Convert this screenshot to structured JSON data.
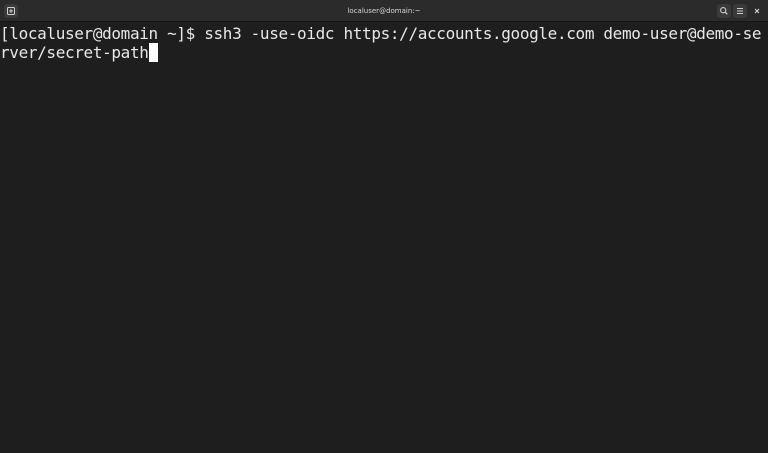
{
  "window": {
    "title": "localuser@domain:~"
  },
  "titlebar": {
    "new_tab_icon": "new-tab-icon",
    "search_icon": "search-icon",
    "menu_icon": "hamburger-menu-icon",
    "close_icon": "close-icon"
  },
  "terminal": {
    "lines": [
      "[localuser@domain ~]$ ssh3 -use-oidc https://accounts.google.com demo-user@demo-se",
      "rver/secret-path"
    ],
    "colors": {
      "background": "#1e1e1e",
      "foreground": "#e8e8e8",
      "cursor": "#ffffff"
    }
  }
}
